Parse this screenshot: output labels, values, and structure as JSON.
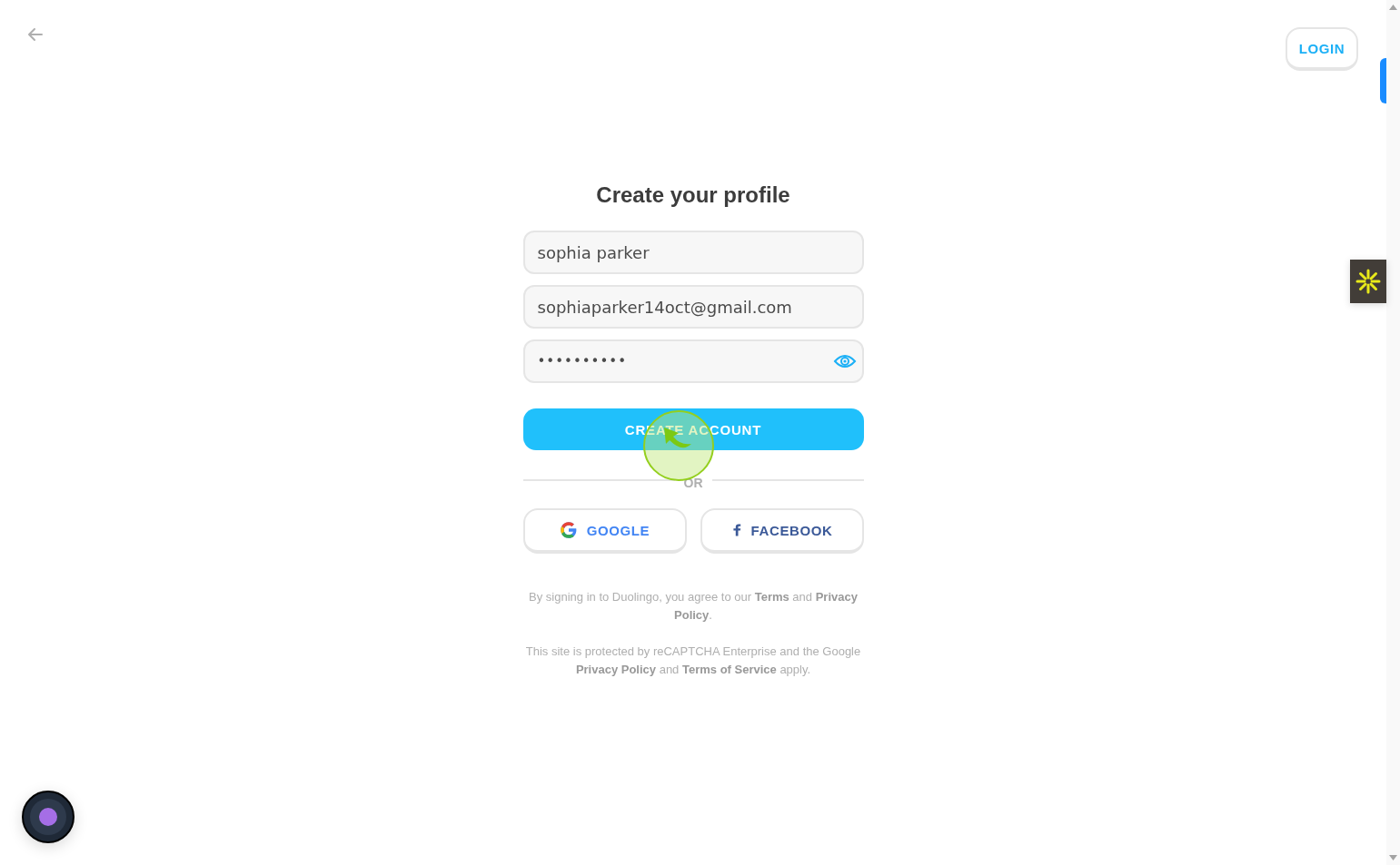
{
  "login_button": "LOGIN",
  "title": "Create your profile",
  "fields": [
    {
      "kind": "text",
      "value": "sophia parker"
    },
    {
      "kind": "text",
      "value": "sophiaparker14oct@gmail.com"
    },
    {
      "kind": "password",
      "value": "••••••••••"
    }
  ],
  "primary_button": "CREATE ACCOUNT",
  "divider": "OR",
  "social_buttons": [
    {
      "kind": "google",
      "label": "GOOGLE"
    },
    {
      "kind": "facebook",
      "label": "FACEBOOK"
    }
  ],
  "terms": "By signing in to Duolingo, you agree to our **Terms** and **Privacy Policy**.",
  "recaptcha": "This site is protected by reCAPTCHA Enterprise and the Google **Privacy Policy** and **Terms of Service** apply."
}
